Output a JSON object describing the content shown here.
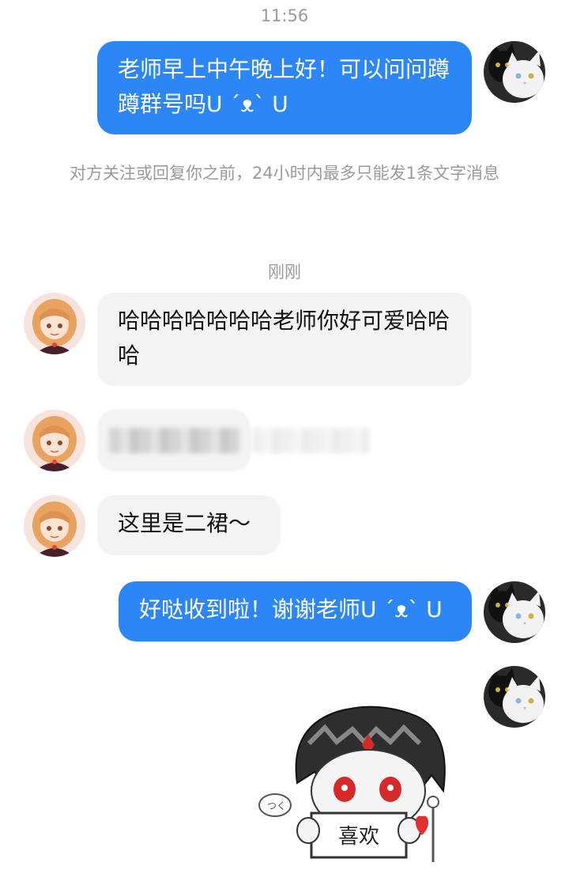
{
  "chat": {
    "time_top": "11:56",
    "time_recent": "刚刚",
    "notice": "对方关注或回复你之前，24小时内最多只能发1条文字消息",
    "messages": [
      {
        "sender": "me",
        "text": "老师早上中午晚上好！可以问问蹲蹲群号吗U ´ᴥ` U"
      },
      {
        "sender": "other",
        "text": "哈哈哈哈哈哈哈老师你好可爱哈哈哈"
      },
      {
        "sender": "other",
        "text": ""
      },
      {
        "sender": "other",
        "text": "这里是二裙～"
      },
      {
        "sender": "me",
        "text": "好哒收到啦！谢谢老师U ´ᴥ` U"
      },
      {
        "sender": "me",
        "text": "喜欢"
      }
    ]
  },
  "avatars": {
    "me": "black-and-white-cats-avatar",
    "other": "anime-girl-avatar"
  },
  "colors": {
    "outgoing_bubble": "#2d86f6",
    "incoming_bubble": "#f3f3f3",
    "meta_text": "#9a9a9a"
  }
}
